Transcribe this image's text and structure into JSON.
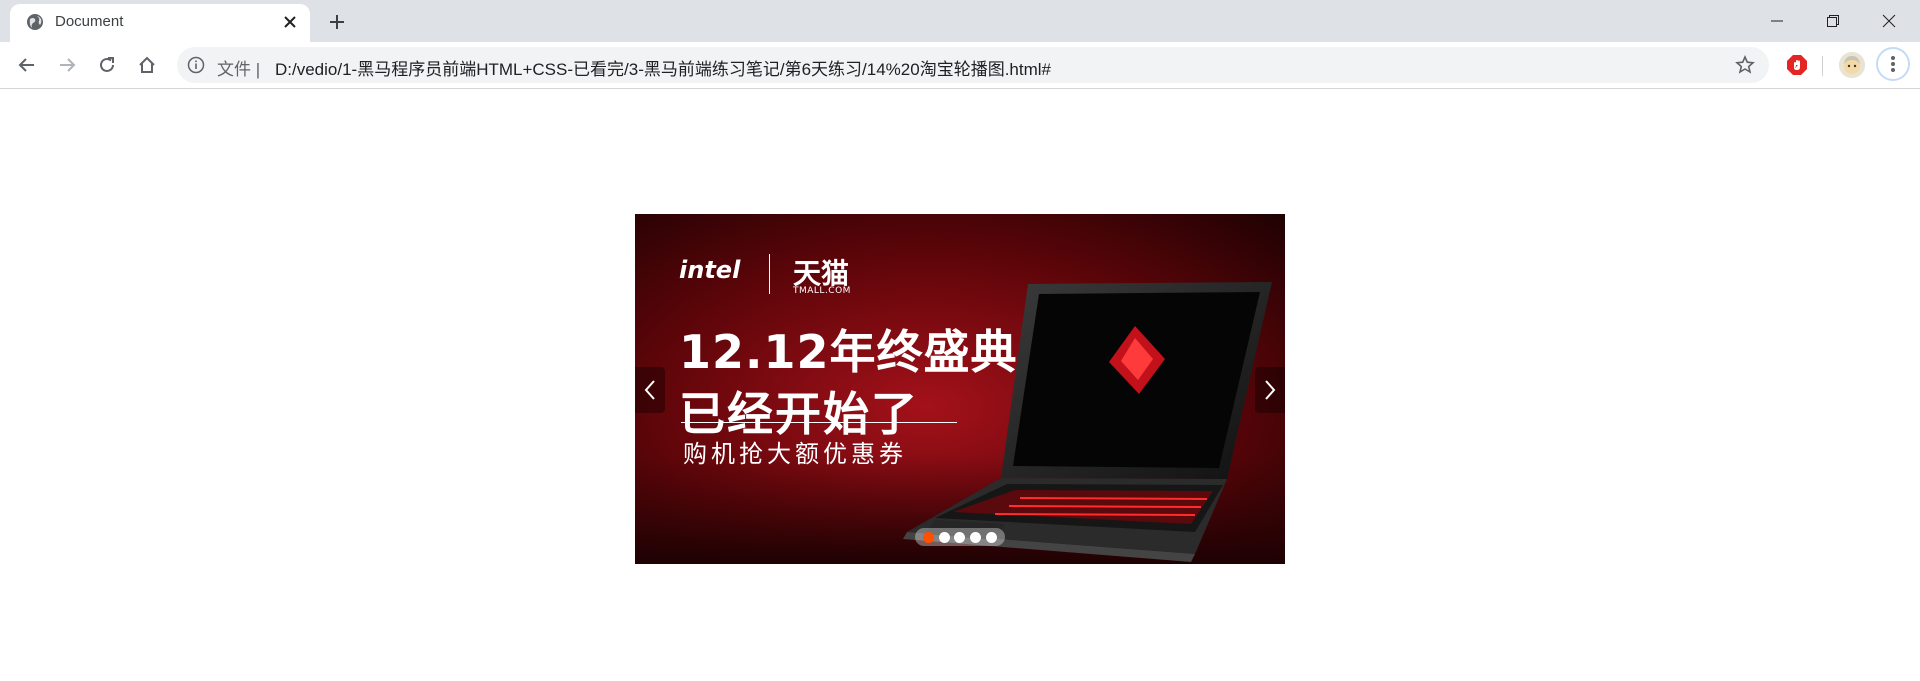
{
  "tab": {
    "title": "Document",
    "favicon": "globe-icon"
  },
  "window_controls": [
    "minimize-icon",
    "restore-icon",
    "close-icon"
  ],
  "toolbar": {
    "scheme_label": "文件",
    "url": "D:/vedio/1-黑马程序员前端HTML+CSS-已看完/3-黑马前端练习笔记/第6天练习/14%20淘宝轮播图.html#"
  },
  "extensions": [
    "adblock-icon"
  ],
  "banner": {
    "brand_intel": "intel",
    "brand_tmall": "天猫",
    "brand_tmall_sub": "TMALL.COM",
    "headline_line1": "12.12年终盛典",
    "headline_line2": "已经开始了",
    "subline": "购机抢大额优惠券"
  },
  "carousel": {
    "slide_count": 5,
    "active_index": 0
  },
  "colors": {
    "active_dot": "#ff5000",
    "tab_strip": "#dee1e6",
    "omnibox": "#f1f3f4",
    "adblock_red": "#e52424"
  }
}
